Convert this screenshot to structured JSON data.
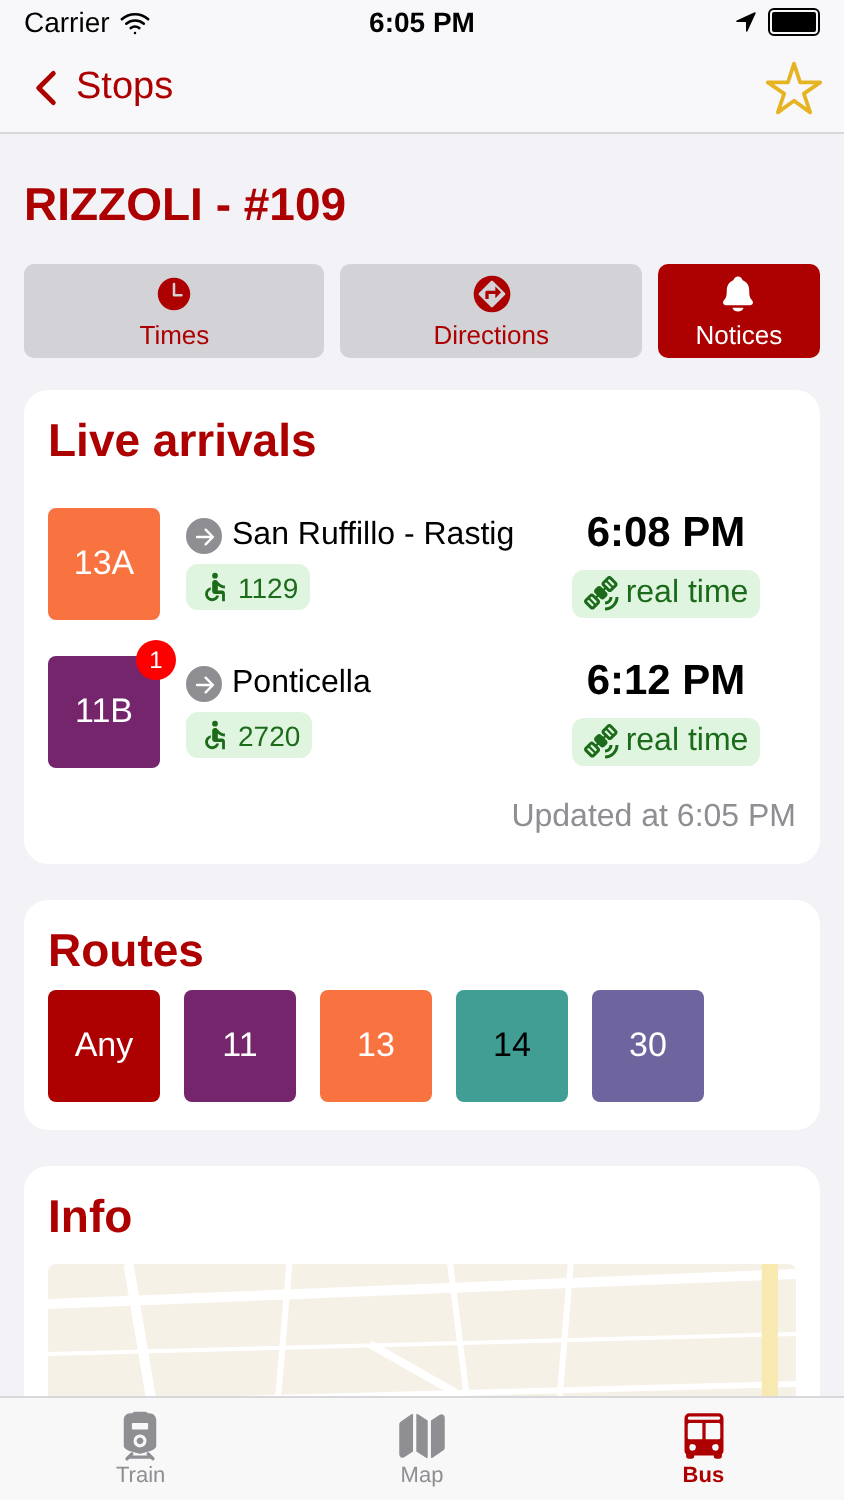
{
  "status_bar": {
    "carrier": "Carrier",
    "time": "6:05 PM"
  },
  "nav": {
    "back": "Stops",
    "favorite": false
  },
  "stop_title": "RIZZOLI - #109",
  "segments": [
    {
      "label": "Times",
      "selected": false
    },
    {
      "label": "Directions",
      "selected": false
    },
    {
      "label": "Notices",
      "selected": true
    }
  ],
  "live_arrivals": {
    "title": "Live arrivals",
    "rows": [
      {
        "route": "13A",
        "color": "#f97340",
        "badge": "",
        "destination": "San Ruffillo - Rastig",
        "vehicle": "1129",
        "time": "6:08 PM",
        "status": "real time"
      },
      {
        "route": "11B",
        "color": "#74256c",
        "badge": "1",
        "destination": "Ponticella",
        "vehicle": "2720",
        "time": "6:12 PM",
        "status": "real time"
      }
    ],
    "updated": "Updated at 6:05 PM"
  },
  "routes": {
    "title": "Routes",
    "items": [
      {
        "label": "Any",
        "color": "#ad0000"
      },
      {
        "label": "11",
        "color": "#74256c"
      },
      {
        "label": "13",
        "color": "#f97340"
      },
      {
        "label": "14",
        "color": "#409e95"
      },
      {
        "label": "30",
        "color": "#6e659e"
      }
    ]
  },
  "info": {
    "title": "Info"
  },
  "tab_bar": [
    {
      "label": "Train",
      "selected": false
    },
    {
      "label": "Map",
      "selected": false
    },
    {
      "label": "Bus",
      "selected": true
    }
  ]
}
